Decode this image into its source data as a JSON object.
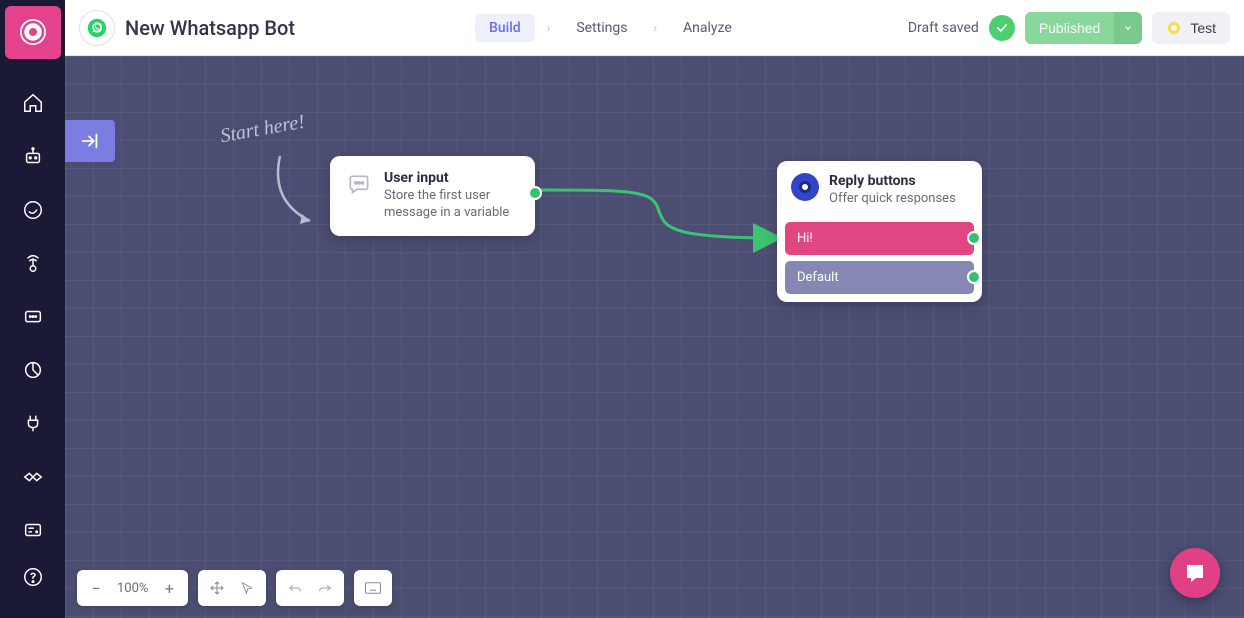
{
  "header": {
    "title": "New Whatsapp Bot",
    "tabs": {
      "build": "Build",
      "settings": "Settings",
      "analyze": "Analyze"
    },
    "draft": "Draft saved",
    "publish": "Published",
    "test": "Test"
  },
  "canvas": {
    "start_label": "Start here!",
    "zoom": "100%",
    "nodes": {
      "user_input": {
        "title": "User input",
        "subtitle": "Store the first user message in a variable"
      },
      "reply": {
        "title": "Reply buttons",
        "subtitle": "Offer quick responses",
        "buttons": {
          "hi": "Hi!",
          "default": "Default"
        }
      }
    }
  },
  "colors": {
    "brand": "#e5428d",
    "accent": "#7b7de0",
    "green": "#36c26b",
    "darkbg": "#1a1936"
  }
}
